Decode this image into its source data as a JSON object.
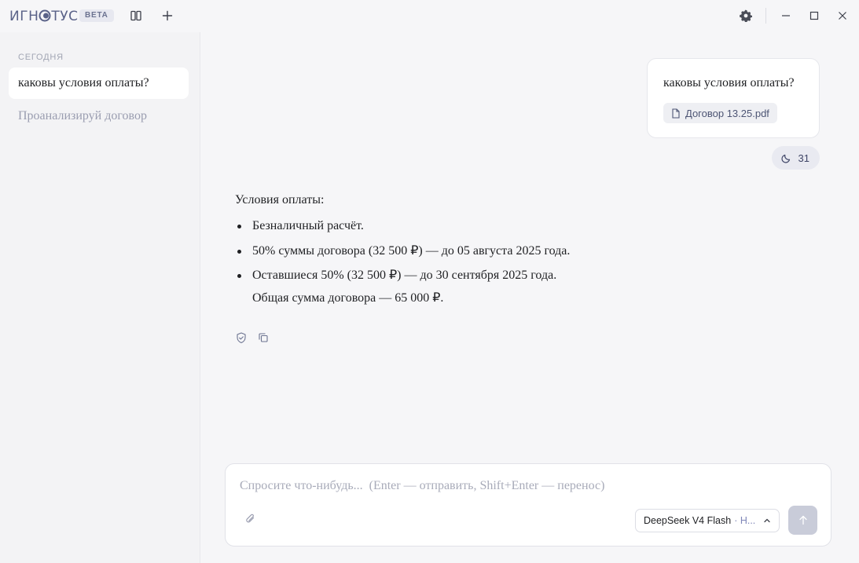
{
  "app": {
    "logo_text": "ИГНОТУС",
    "logo_prefix": "ИГН",
    "logo_suffix": "ТУС",
    "beta_badge": "BETA"
  },
  "sidebar": {
    "section_label": "СЕГОДНЯ",
    "items": [
      {
        "label": "каковы условия оплаты?",
        "active": true
      },
      {
        "label": "Проанализируй договор",
        "active": false
      }
    ]
  },
  "conversation": {
    "user_message": "каковы условия оплаты?",
    "attachment_name": "Договор 13.25.pdf",
    "time_badge": "31",
    "answer": {
      "intro": "Условия оплаты:",
      "bullets": [
        "Безналичный расчёт.",
        "50% суммы договора (32 500 ₽) — до 05 августа 2025 года.",
        "Оставшиеся 50% (32 500 ₽) — до 30 сентября 2025 года."
      ],
      "total": "Общая сумма договора — 65 000 ₽."
    }
  },
  "composer": {
    "placeholder": "Спросите что-нибудь...  (Enter — отправить, Shift+Enter — перенос)",
    "model_name": "DeepSeek V4 Flash",
    "model_mode": "· Н..."
  },
  "colors": {
    "accent": "#5a6288",
    "send_disabled": "#c9ccd9",
    "sidebar_bg": "#f3f3f5"
  },
  "icons": {
    "sidebar_toggle": "split-panel-icon",
    "new_chat": "plus-icon",
    "settings": "gear-icon",
    "minimize": "minimize-icon",
    "maximize": "maximize-icon",
    "close": "close-icon",
    "attachment": "file-icon",
    "time": "moon-icon",
    "verify": "shield-check-icon",
    "copy": "copy-icon",
    "attach": "paperclip-icon",
    "chevron": "chevron-up-icon",
    "send": "arrow-up-icon"
  }
}
